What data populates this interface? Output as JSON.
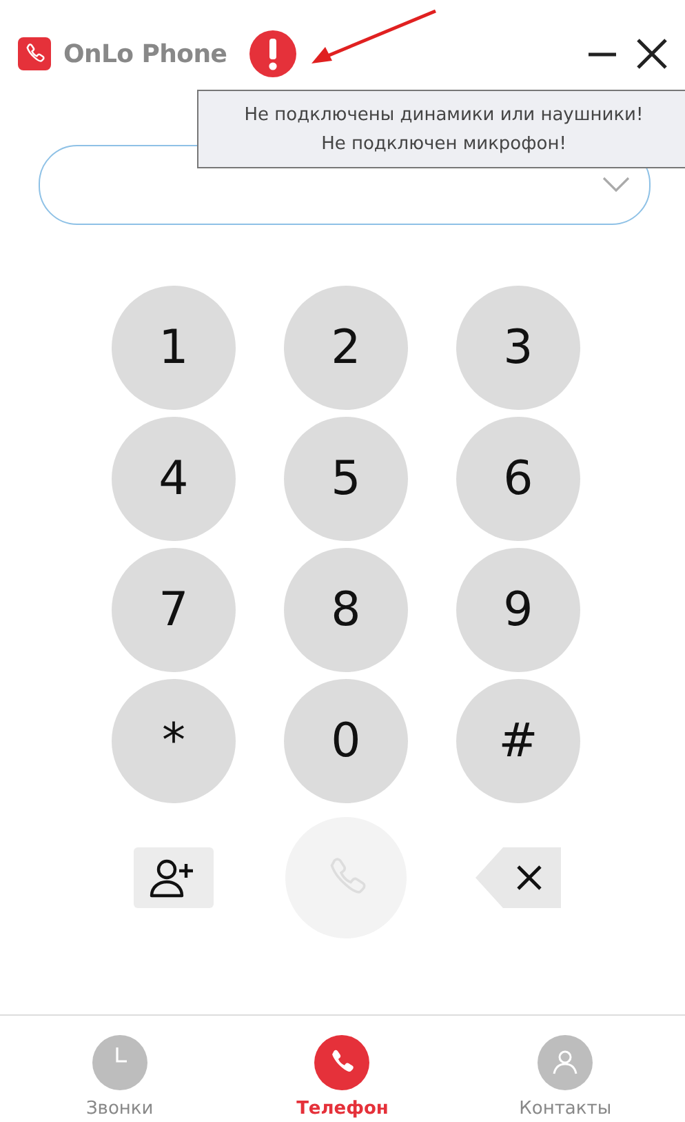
{
  "window": {
    "title": "OnLo Phone",
    "warning": true
  },
  "tooltip": {
    "lines": [
      "Не подключены динамики или наушники!",
      "Не подключен микрофон!"
    ]
  },
  "keypad": [
    {
      "label": "1"
    },
    {
      "label": "2"
    },
    {
      "label": "3"
    },
    {
      "label": "4"
    },
    {
      "label": "5"
    },
    {
      "label": "6"
    },
    {
      "label": "7"
    },
    {
      "label": "8"
    },
    {
      "label": "9"
    },
    {
      "label": "*"
    },
    {
      "label": "0"
    },
    {
      "label": "#"
    }
  ],
  "call_button": {
    "disabled": true
  },
  "tabs": [
    {
      "label": "Звонки",
      "kind": "clock",
      "selected": false
    },
    {
      "label": "Телефон",
      "kind": "phone",
      "selected": true
    },
    {
      "label": "Контакты",
      "kind": "person",
      "selected": false
    }
  ]
}
